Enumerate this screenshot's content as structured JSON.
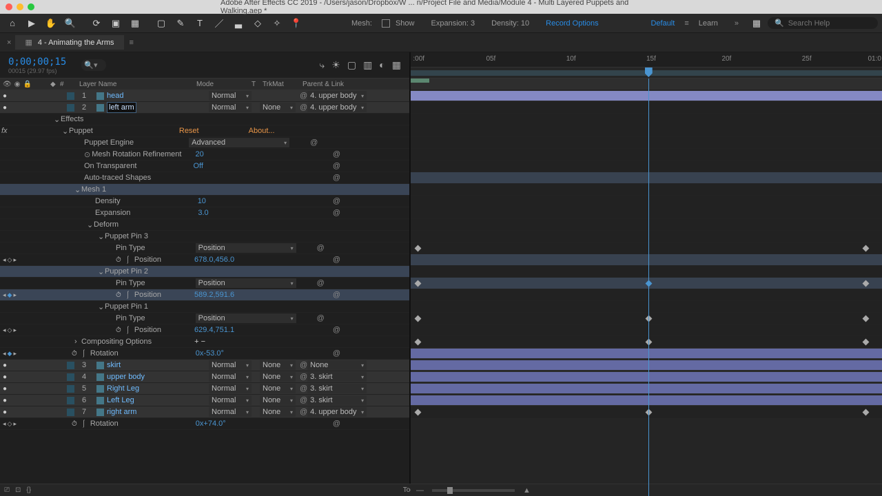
{
  "title": "Adobe After Effects CC 2019 - /Users/jason/Dropbox/W ... n/Project File and Media/Module 4 - Multi Layered Puppets and Walking.aep *",
  "toolbar_opts": {
    "mesh": "Mesh:",
    "show": "Show",
    "exp": "Expansion: 3",
    "den": "Density: 10",
    "rec": "Record Options",
    "ws_default": "Default",
    "learn": "Learn"
  },
  "search_ph": "Search Help",
  "comp_name": "4 - Animating the Arms",
  "timecode": "0;00;00;15",
  "frameinfo": "00015 (29.97 fps)",
  "cols": {
    "idx": "#",
    "name": "Layer Name",
    "mode": "Mode",
    "t": "T",
    "trk": "TrkMat",
    "parent": "Parent & Link"
  },
  "modes": {
    "normal": "Normal",
    "none": "None"
  },
  "parents": {
    "upper4": "4. upper body",
    "skirt3": "3. skirt",
    "none": "None"
  },
  "effects_label": "Effects",
  "puppet": {
    "label": "Puppet",
    "reset": "Reset",
    "about": "About...",
    "engine_l": "Puppet Engine",
    "engine_v": "Advanced",
    "mrr_l": "Mesh Rotation Refinement",
    "mrr_v": "20",
    "ot_l": "On Transparent",
    "ot_v": "Off",
    "auto_l": "Auto-traced Shapes",
    "mesh_l": "Mesh 1",
    "den_l": "Density",
    "den_v": "10",
    "exp_l": "Expansion",
    "exp_v": "3.0",
    "deform_l": "Deform",
    "pin3": "Puppet Pin 3",
    "pin2": "Puppet Pin 2",
    "pin1": "Puppet Pin 1",
    "pintype_l": "Pin Type",
    "pintype_v": "Position",
    "pos_l": "Position",
    "p3": "678.0,456.0",
    "p2": "589.2,591.6",
    "p1": "629.4,751.1",
    "compopt": "Compositing Options"
  },
  "rotation_l": "Rotation",
  "rot1": "0x-53.0°",
  "rot2": "0x+74.0°",
  "layers": [
    {
      "idx": "1",
      "name": "head"
    },
    {
      "idx": "2",
      "name": "left arm"
    },
    {
      "idx": "3",
      "name": "skirt"
    },
    {
      "idx": "4",
      "name": "upper body"
    },
    {
      "idx": "5",
      "name": "Right Leg"
    },
    {
      "idx": "6",
      "name": "Left Leg"
    },
    {
      "idx": "7",
      "name": "right arm"
    }
  ],
  "ruler": [
    ":00f",
    "05f",
    "10f",
    "15f",
    "20f",
    "25f",
    "01:0"
  ],
  "toggle": "Toggle Switches / Modes"
}
